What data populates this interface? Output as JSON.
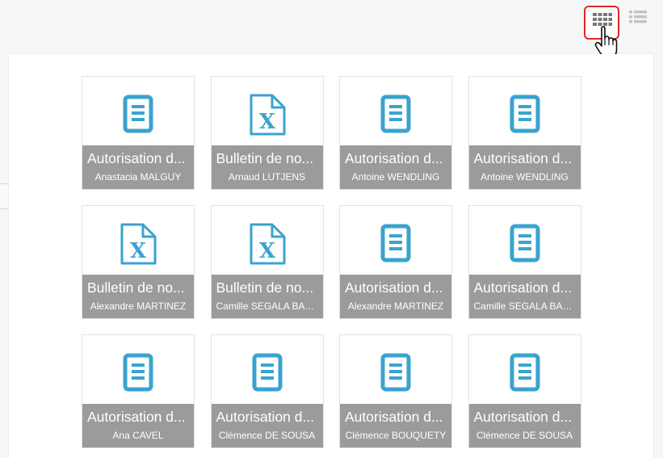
{
  "colors": {
    "icon_blue": "#3aa3cf",
    "caption_bg": "#9b9b9b",
    "active_border": "#e0262b"
  },
  "toolbar": {
    "grid_view_icon": "grid-view-icon",
    "list_view_icon": "list-view-icon",
    "active_view": "grid"
  },
  "files": [
    {
      "title": "Autorisation d...",
      "owner": "Anastacia MALGUY",
      "type": "document"
    },
    {
      "title": "Bulletin de no...",
      "owner": "Arnaud LUTJENS",
      "type": "excel"
    },
    {
      "title": "Autorisation d...",
      "owner": "Antoine WENDLING",
      "type": "document"
    },
    {
      "title": "Autorisation d...",
      "owner": "Antoine WENDLING",
      "type": "document"
    },
    {
      "title": "Bulletin de no...",
      "owner": "Alexandre MARTINEZ",
      "type": "excel"
    },
    {
      "title": "Bulletin de no...",
      "owner": "Camille SEGALA BAD...",
      "type": "excel"
    },
    {
      "title": "Autorisation d...",
      "owner": "Alexandre MARTINEZ",
      "type": "document"
    },
    {
      "title": "Autorisation d...",
      "owner": "Camille SEGALA BAD...",
      "type": "document"
    },
    {
      "title": "Autorisation d...",
      "owner": "Ana CAVEL",
      "type": "document"
    },
    {
      "title": "Autorisation d...",
      "owner": "Clémence DE SOUSA",
      "type": "document"
    },
    {
      "title": "Autorisation d...",
      "owner": "Clémence BOUQUETY",
      "type": "document"
    },
    {
      "title": "Autorisation d...",
      "owner": "Clémence DE SOUSA",
      "type": "document"
    }
  ]
}
